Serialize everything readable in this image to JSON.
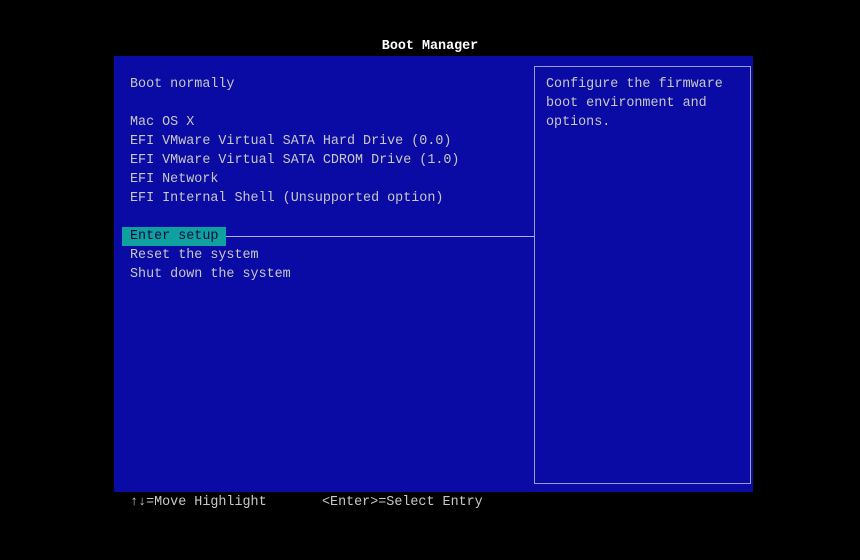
{
  "title": "Boot Manager",
  "menu": {
    "items": [
      {
        "label": "Boot normally"
      },
      {
        "label": "Mac OS X"
      },
      {
        "label": "EFI VMware Virtual SATA Hard Drive (0.0)"
      },
      {
        "label": "EFI VMware Virtual SATA CDROM Drive (1.0)"
      },
      {
        "label": "EFI Network"
      },
      {
        "label": "EFI Internal Shell (Unsupported option)"
      },
      {
        "label": "Enter setup",
        "selected": true
      },
      {
        "label": "Reset the system"
      },
      {
        "label": "Shut down the system"
      }
    ]
  },
  "help": {
    "lines": [
      "Configure the firmware",
      "boot environment and",
      "options."
    ]
  },
  "footer": {
    "move": "↑↓=Move Highlight",
    "select": "<Enter>=Select Entry"
  },
  "colors": {
    "background": "#0a0aa4",
    "highlight": "#0fa0a0"
  }
}
